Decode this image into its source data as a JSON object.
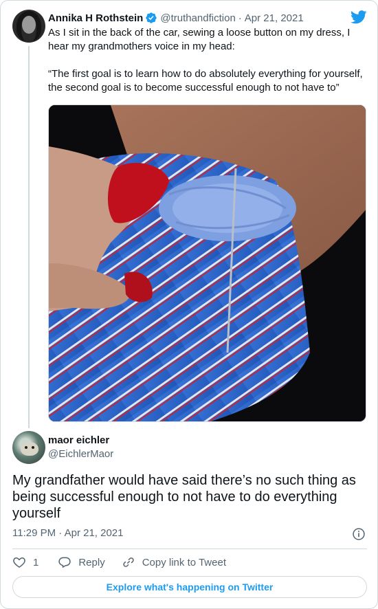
{
  "tweet": {
    "author_name": "Annika H Rothstein",
    "author_handle": "@truthandfiction",
    "separator": "·",
    "date": "Apr 21, 2021",
    "text_line1": "As I sit in the back of the car, sewing a loose button on my dress, I hear my grandmothers voice in my head:",
    "text_line2": "“The first goal is to learn how to do absolutely everything for yourself, the second goal is to become successful enough to not have to”"
  },
  "reply": {
    "author_name": "maor eichler",
    "author_handle": "@EichlerMaor",
    "text": "My grandfather would have said there’s no such thing as being successful enough to not have to do everything yourself",
    "timestamp": "11:29 PM · Apr 21, 2021"
  },
  "actions": {
    "like_count": "1",
    "reply_label": "Reply",
    "copy_label": "Copy link to Tweet"
  },
  "explore_label": "Explore what's happening on Twitter",
  "icons": {
    "verified": "verified-badge-icon",
    "logo": "twitter-bird-icon",
    "info": "info-icon",
    "like": "heart-icon",
    "reply": "speech-bubble-icon",
    "copy": "link-icon"
  },
  "colors": {
    "accent": "#1d9bf0",
    "text": "#0f1419",
    "secondary": "#536471",
    "border": "#cfd9de"
  }
}
